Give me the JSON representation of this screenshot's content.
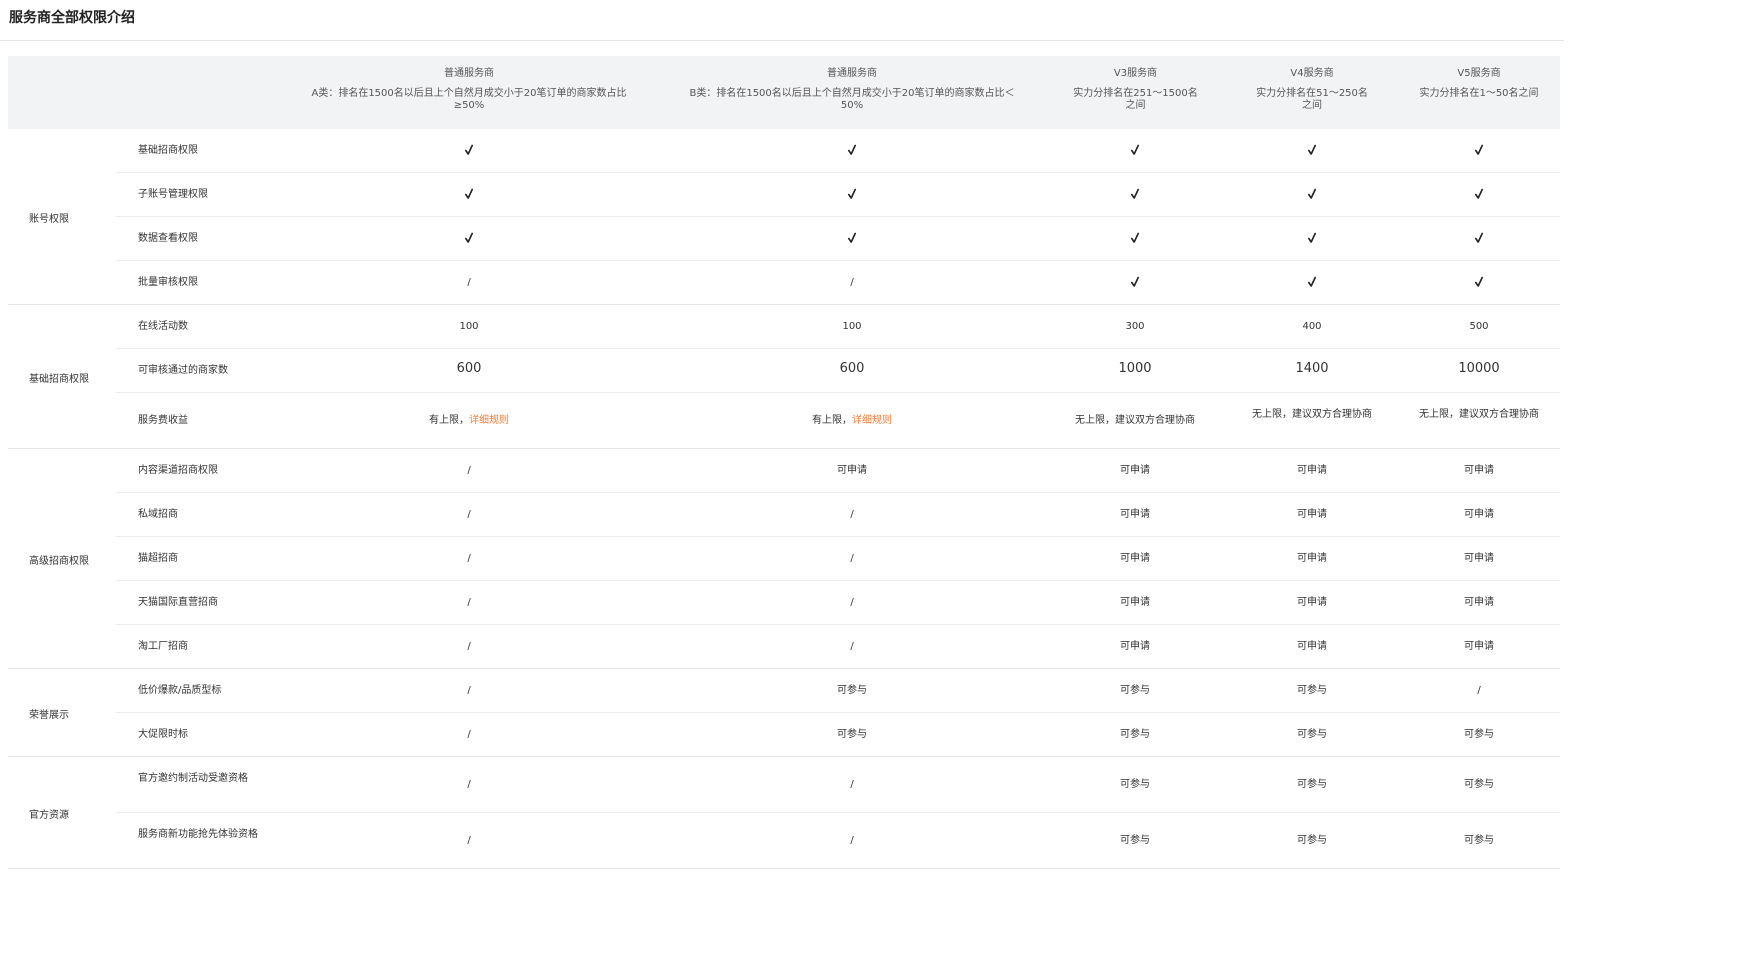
{
  "page_title": "服务商全部权限介绍",
  "columns": [
    {
      "title": "普通服务商",
      "desc": "A类：排名在1500名以后且上个自然月成交小于20笔订单的商家数占比≥50%"
    },
    {
      "title": "普通服务商",
      "desc": "B类：排名在1500名以后且上个自然月成交小于20笔订单的商家数占比＜50%"
    },
    {
      "title": "V3服务商",
      "desc": "实力分排名在251～1500名之间"
    },
    {
      "title": "V4服务商",
      "desc": "实力分排名在51～250名之间"
    },
    {
      "title": "V5服务商",
      "desc": "实力分排名在1～50名之间"
    }
  ],
  "groups": [
    {
      "label": "账号权限",
      "rows": [
        {
          "label": "基础招商权限",
          "cells": [
            "✓",
            "✓",
            "✓",
            "✓",
            "✓"
          ]
        },
        {
          "label": "子账号管理权限",
          "cells": [
            "✓",
            "✓",
            "✓",
            "✓",
            "✓"
          ]
        },
        {
          "label": "数据查看权限",
          "cells": [
            "✓",
            "✓",
            "✓",
            "✓",
            "✓"
          ]
        },
        {
          "label": "批量审核权限",
          "cells": [
            "/",
            "/",
            "✓",
            "✓",
            "✓"
          ]
        }
      ]
    },
    {
      "label": "基础招商权限",
      "rows": [
        {
          "label": "在线活动数",
          "cells": [
            "100",
            "100",
            "300",
            "400",
            "500"
          ]
        },
        {
          "label": "可审核通过的商家数",
          "cells": [
            "600",
            "600",
            "1000",
            "1400",
            "10000"
          ],
          "big": true
        },
        {
          "label": "服务费收益",
          "cells": [
            "有上限，",
            "有上限，",
            "无上限，建议双方合理协商",
            "无上限，建议双方合理协商",
            "无上限，建议双方合理协商"
          ],
          "links": [
            "详细规则",
            "详细规则",
            "",
            "",
            ""
          ]
        }
      ]
    },
    {
      "label": "高级招商权限",
      "rows": [
        {
          "label": "内容渠道招商权限",
          "cells": [
            "/",
            "可申请",
            "可申请",
            "可申请",
            "可申请"
          ]
        },
        {
          "label": "私域招商",
          "cells": [
            "/",
            "/",
            "可申请",
            "可申请",
            "可申请"
          ]
        },
        {
          "label": "猫超招商",
          "cells": [
            "/",
            "/",
            "可申请",
            "可申请",
            "可申请"
          ]
        },
        {
          "label": "天猫国际直营招商",
          "cells": [
            "/",
            "/",
            "可申请",
            "可申请",
            "可申请"
          ]
        },
        {
          "label": "淘工厂招商",
          "cells": [
            "/",
            "/",
            "可申请",
            "可申请",
            "可申请"
          ]
        }
      ]
    },
    {
      "label": "荣誉展示",
      "rows": [
        {
          "label": "低价爆款/品质型标",
          "cells": [
            "/",
            "可参与",
            "可参与",
            "可参与",
            "/"
          ]
        },
        {
          "label": "大促限时标",
          "cells": [
            "/",
            "可参与",
            "可参与",
            "可参与",
            "可参与"
          ]
        }
      ]
    },
    {
      "label": "官方资源",
      "rows": [
        {
          "label": "官方邀约制活动受邀资格",
          "cells": [
            "/",
            "/",
            "可参与",
            "可参与",
            "可参与"
          ]
        },
        {
          "label": "服务商新功能抢先体验资格",
          "cells": [
            "/",
            "/",
            "可参与",
            "可参与",
            "可参与"
          ]
        }
      ]
    }
  ]
}
